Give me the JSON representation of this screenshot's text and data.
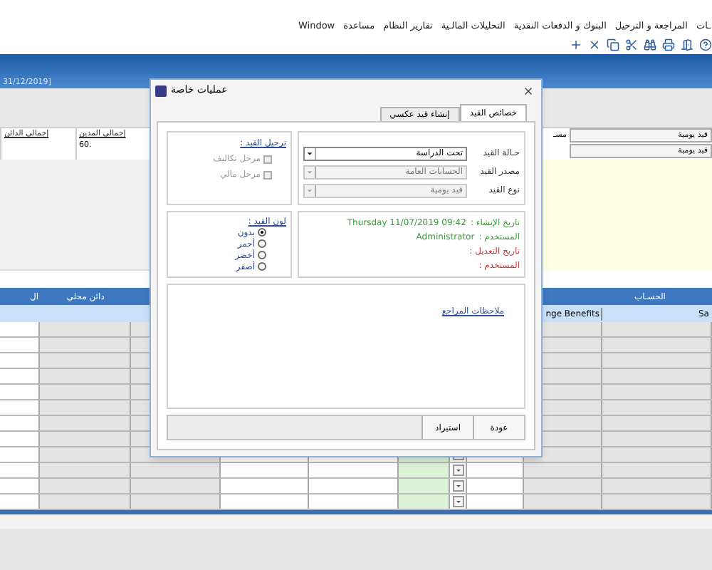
{
  "menu": [
    "ـات",
    "المراجعة و الترحيل",
    "البنوك و الدفعات النقدية",
    "التحليلات المالـية",
    "تقارير النظام",
    "مساعدة",
    "Window"
  ],
  "header_band": {
    "date_text": "31/12/2019]"
  },
  "form": {
    "label": "مسـ",
    "fields": [
      "قيد يومية",
      "قيد يومية"
    ],
    "totals": [
      {
        "label": "إجمالي المدين",
        "value": ".60"
      },
      {
        "label": "إجمالي الدائن"
      }
    ]
  },
  "grid": {
    "headers": [
      "الحسـاب",
      "دائن محلي",
      "ال"
    ],
    "subheaders": [
      "Sa",
      "nge Benefits"
    ]
  },
  "dialog": {
    "title": "عمليات خاصة",
    "tabs": [
      {
        "label": "خصائص القيد",
        "selected": true
      },
      {
        "label": "إنشاء قيد عكسي",
        "selected": false
      }
    ],
    "fields": [
      {
        "label": "حـالة القيد",
        "value": "تحت الدراسة",
        "disabled": false
      },
      {
        "label": "مصدر القيد",
        "value": "الحسابات العامة",
        "disabled": true
      },
      {
        "label": "نوع القيد",
        "value": "قيد يومية",
        "disabled": true
      }
    ],
    "posting": {
      "title": "ترحيل القيد :",
      "options": [
        {
          "label": "مرحل تكاليف",
          "checked": false,
          "disabled": true
        },
        {
          "label": "مرحل مالي",
          "checked": false,
          "disabled": true
        }
      ]
    },
    "entry_color": {
      "title": "لون القيد :",
      "options": [
        {
          "label": "بدون",
          "selected": true
        },
        {
          "label": "أحمر",
          "selected": false
        },
        {
          "label": "أخضر",
          "selected": false
        },
        {
          "label": "أصفر",
          "selected": false
        }
      ]
    },
    "audit": [
      {
        "label": "تاريخ الإنشاء :",
        "value": "Thursday 11/07/2019 09:42",
        "color": "#3a9a3a"
      },
      {
        "label": "المستخدم :",
        "value": "Administrator",
        "color": "#3a9a3a"
      },
      {
        "label": "تاريخ التعديل :",
        "color": "#d83030"
      },
      {
        "label": "المستخدم :",
        "color": "#d83030"
      }
    ],
    "notes": {
      "title": "ملاحظات المراجع"
    },
    "buttons": [
      "عودة",
      "استيراد"
    ]
  }
}
